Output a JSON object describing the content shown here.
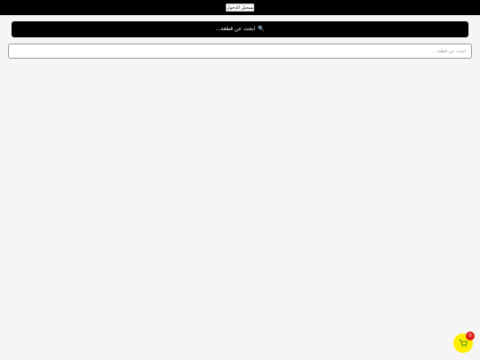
{
  "header": {
    "login_label": "تسجيل الدخول"
  },
  "search": {
    "banner_icon": "magnifier-icon",
    "banner_label": "ابحث عن قطعة...",
    "input_placeholder": "ابحث عن قطعة..."
  },
  "cart": {
    "icon": "cart-icon",
    "count": "0"
  },
  "colors": {
    "topbar": "#000000",
    "background": "#f5f5f5",
    "cart_button": "#ffee00",
    "badge": "#e01b1b"
  }
}
